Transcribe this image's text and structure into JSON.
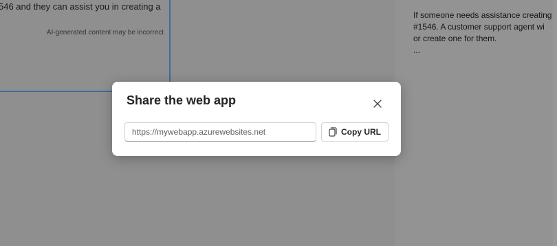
{
  "background": {
    "chat": {
      "message_fragment": "546 and they can assist you in creating a",
      "disclaimer": "AI-generated content may be incorrect"
    },
    "side_panel": {
      "lines": [
        "If someone needs assistance creating",
        "#1546. A customer support agent wi",
        "or create one for them.",
        "..."
      ]
    }
  },
  "dialog": {
    "title": "Share the web app",
    "close_icon": "close-icon",
    "url_field": {
      "value": "https://mywebapp.azurewebsites.net",
      "placeholder": ""
    },
    "copy_button": {
      "label": "Copy URL",
      "icon": "copy-icon"
    }
  },
  "colors": {
    "overlay": "#8e8e8e",
    "dialog_bg": "#ffffff",
    "chat_border": "#3f6a9c",
    "title_text": "#242424"
  }
}
